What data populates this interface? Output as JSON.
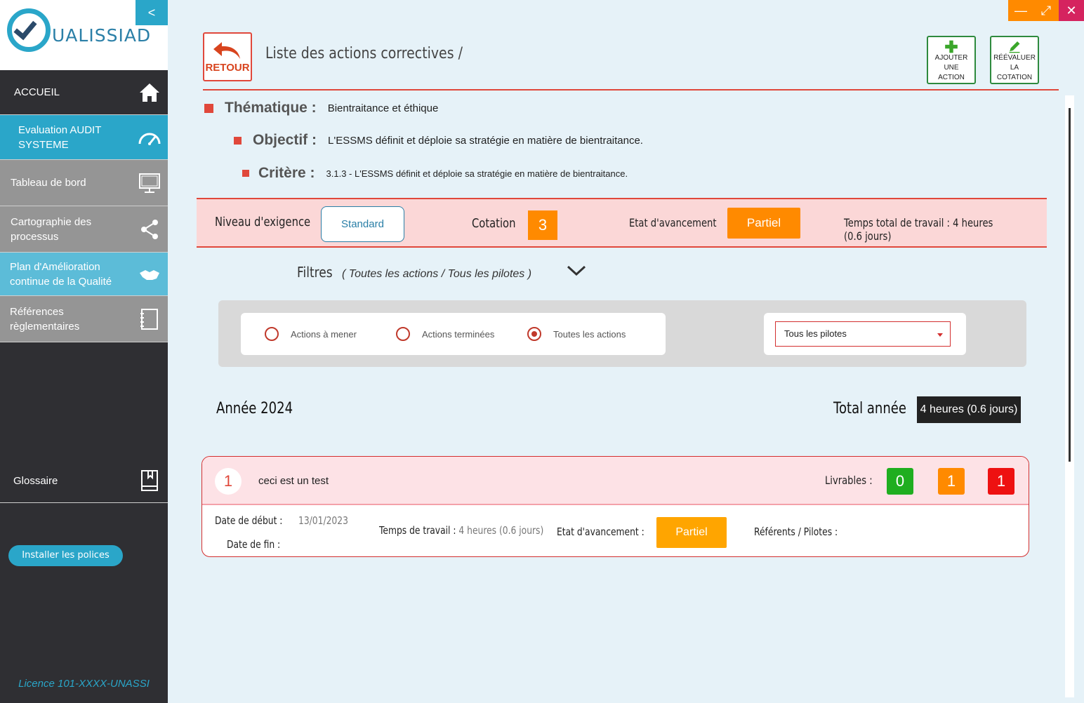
{
  "sidebar": {
    "logo_text": "UALISSIAD",
    "collapse_label": "<",
    "items": [
      {
        "label": "ACCUEIL",
        "icon": "home-icon"
      },
      {
        "label": "Evaluation AUDIT SYSTEME",
        "icon": "gauge-icon"
      },
      {
        "label": "Tableau de bord",
        "icon": "monitor-icon"
      },
      {
        "label": "Cartographie des processus",
        "icon": "share-icon"
      },
      {
        "label": "Plan d'Amélioration continue de la Qualité",
        "icon": "handshake-icon"
      },
      {
        "label": "Références règlementaires",
        "icon": "notebook-icon"
      },
      {
        "label": "Glossaire",
        "icon": "book-icon"
      }
    ],
    "install_button": "Installer les polices",
    "licence": "Licence 101-XXXX-UNASSI"
  },
  "window_controls": {
    "minimize": "—",
    "maximize": "⤢",
    "close": "✕"
  },
  "header": {
    "retour_label": "RETOUR",
    "title": "Liste des actions correctives /",
    "add_action": {
      "line1": "AJOUTER UNE",
      "line2": "ACTION"
    },
    "reevaluate": {
      "line1": "RÉÉVALUER LA",
      "line2": "COTATION"
    }
  },
  "info": {
    "thematique_label": "Thématique :",
    "thematique_value": "Bientraitance et éthique",
    "objectif_label": "Objectif :",
    "objectif_value": "L'ESSMS définit et déploie sa stratégie en matière de bientraitance.",
    "critere_label": "Critère :",
    "critere_value": "3.1.3 - L'ESSMS définit et déploie sa stratégie en matière de bientraitance."
  },
  "banner": {
    "niveau_label": "Niveau d'exigence",
    "niveau_value": "Standard",
    "cotation_label": "Cotation",
    "cotation_value": "3",
    "etat_label": "Etat d'avancement",
    "etat_value": "Partiel",
    "temps_total": "Temps total de travail : 4 heures (0.6 jours)"
  },
  "filters": {
    "label": "Filtres",
    "summary": "( Toutes les actions / Tous les pilotes )",
    "radios": [
      {
        "label": "Actions à mener",
        "checked": false
      },
      {
        "label": "Actions terminées",
        "checked": false
      },
      {
        "label": "Toutes les actions",
        "checked": true
      }
    ],
    "pilot_select": "Tous les pilotes"
  },
  "year": {
    "label": "Année 2024",
    "total_label": "Total année",
    "total_value": "4 heures (0.6 jours)"
  },
  "actions": [
    {
      "number": "1",
      "title": "ceci est un test",
      "livrables_label": "Livrables :",
      "livrables": [
        {
          "value": "0",
          "color": "#1fae1f"
        },
        {
          "value": "1",
          "color": "#ff8a00"
        },
        {
          "value": "1",
          "color": "#ee1111"
        }
      ],
      "date_debut_label": "Date de début :",
      "date_debut_value": "13/01/2023",
      "date_fin_label": "Date de fin :",
      "temps_label": "Temps de travail :",
      "temps_value": "4 heures (0.6 jours)",
      "etat_label": "Etat d'avancement :",
      "etat_value": "Partiel",
      "referents_label": "Référents / Pilotes :"
    }
  ],
  "colors": {
    "accent_teal": "#2aa6c9",
    "accent_red": "#e0483b",
    "orange": "#ff8a00",
    "sidebar_dark": "#2f2f33"
  }
}
